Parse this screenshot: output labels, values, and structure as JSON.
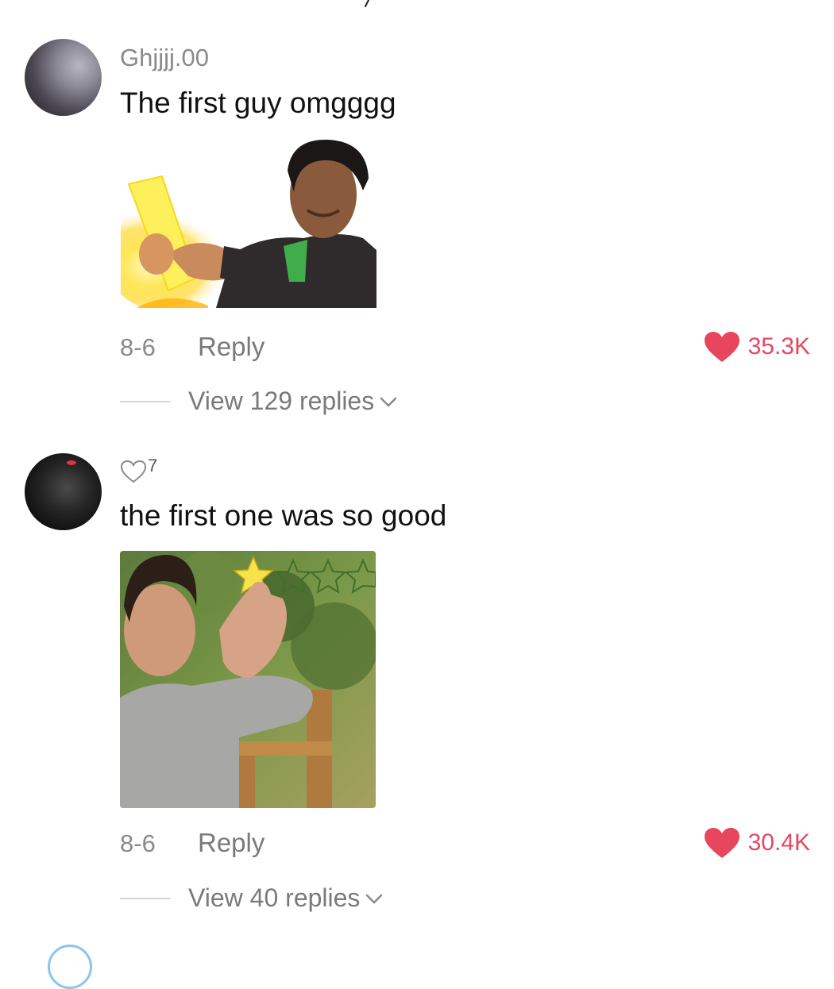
{
  "comments": [
    {
      "username": "Ghjjjj.00",
      "text": "The first guy omgggg",
      "date": "8-6",
      "reply_label": "Reply",
      "likes": "35.3K",
      "view_replies": "View 129 replies"
    },
    {
      "small_like_count": "7",
      "text": "the first one was so good",
      "date": "8-6",
      "reply_label": "Reply",
      "likes": "30.4K",
      "view_replies": "View 40 replies"
    }
  ],
  "colors": {
    "like_red": "#e8465f",
    "muted_gray": "#8a8a8a",
    "text_dark": "#111111"
  },
  "icons": [
    "heart-filled-icon",
    "heart-outline-icon",
    "chevron-down-icon"
  ]
}
